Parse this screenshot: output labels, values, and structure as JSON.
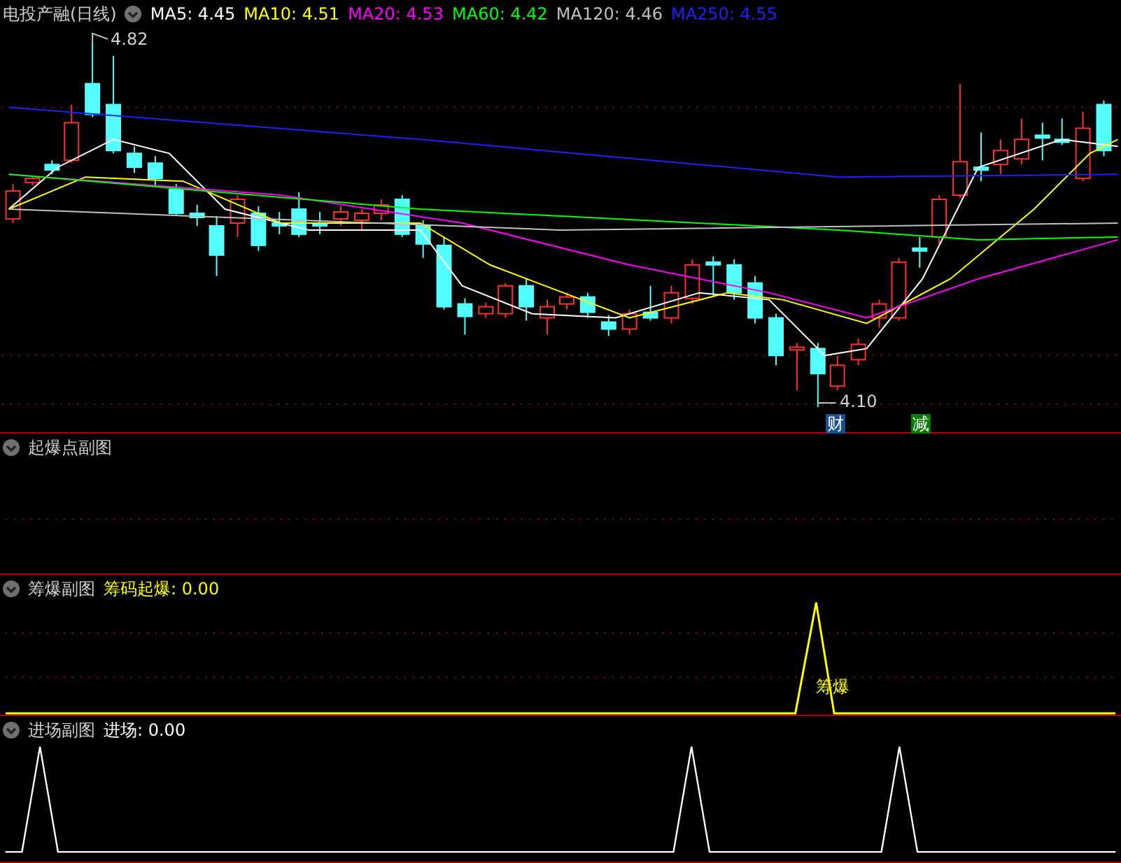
{
  "main": {
    "title": "电投产融(日线)",
    "ma": [
      {
        "label": "MA5: 4.45",
        "color": "#ffffff"
      },
      {
        "label": "MA10: 4.51",
        "color": "#ffff00"
      },
      {
        "label": "MA20: 4.53",
        "color": "#ff00ff"
      },
      {
        "label": "MA60: 4.42",
        "color": "#00ff00"
      },
      {
        "label": "MA120: 4.46",
        "color": "#c0c0c0"
      },
      {
        "label": "MA250: 4.55",
        "color": "#2020ff"
      }
    ],
    "high_label": "4.82",
    "low_label": "4.10",
    "markers": [
      {
        "text": "财",
        "color": "#1c4e8a"
      },
      {
        "text": "减",
        "color": "#0a7a0a"
      }
    ]
  },
  "panels": [
    {
      "kind": "blank",
      "title": "起爆点副图"
    },
    {
      "kind": "chips",
      "title": "筹爆副图",
      "reading": "筹码起爆: 0.00",
      "signal_label": "筹爆"
    },
    {
      "kind": "entry",
      "title": "进场副图",
      "reading": "进场: 0.00"
    }
  ]
}
